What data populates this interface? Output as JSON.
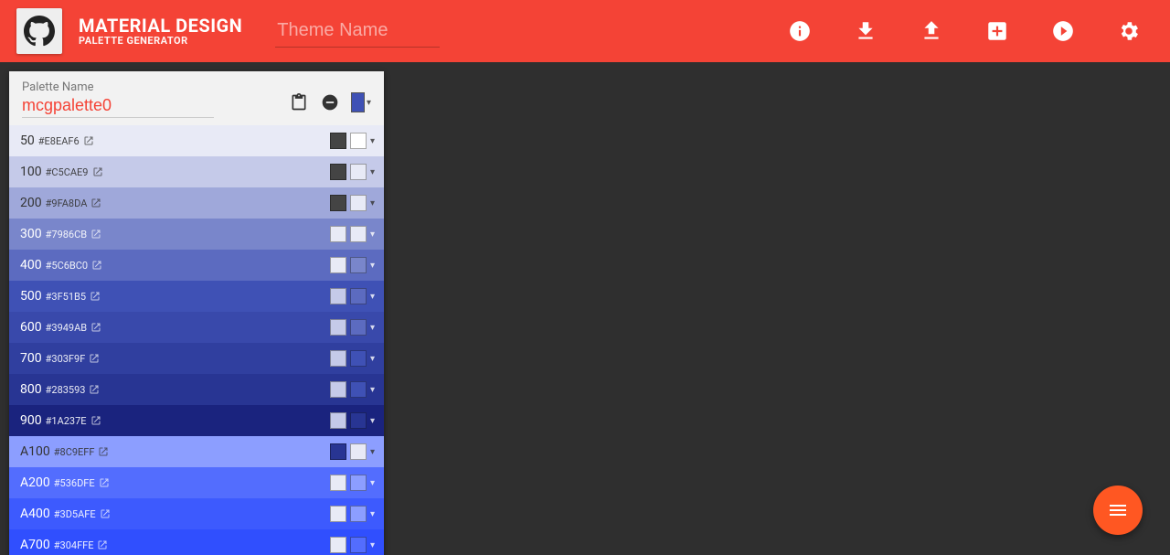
{
  "header": {
    "title": "MATERIAL DESIGN",
    "subtitle": "PALETTE GENERATOR",
    "theme_placeholder": "Theme Name",
    "theme_value": ""
  },
  "palette": {
    "name_label": "Palette Name",
    "name_value": "mcgpalette0",
    "base_color": "#3F51B5",
    "shades": [
      {
        "key": "50",
        "hex": "#E8EAF6",
        "bg": "#E8EAF6",
        "text": "dark",
        "dark_sw": "#444444",
        "light_sw": "#FFFFFF"
      },
      {
        "key": "100",
        "hex": "#C5CAE9",
        "bg": "#C5CAE9",
        "text": "dark",
        "dark_sw": "#444444",
        "light_sw": "#E8EAF6"
      },
      {
        "key": "200",
        "hex": "#9FA8DA",
        "bg": "#9FA8DA",
        "text": "dark",
        "dark_sw": "#444444",
        "light_sw": "#E8EAF6"
      },
      {
        "key": "300",
        "hex": "#7986CB",
        "bg": "#7986CB",
        "text": "light",
        "dark_sw": "#E8EAF6",
        "light_sw": "#E8EAF6"
      },
      {
        "key": "400",
        "hex": "#5C6BC0",
        "bg": "#5C6BC0",
        "text": "light",
        "dark_sw": "#E8EAF6",
        "light_sw": "#7986CB"
      },
      {
        "key": "500",
        "hex": "#3F51B5",
        "bg": "#3F51B5",
        "text": "light",
        "dark_sw": "#C5CAE9",
        "light_sw": "#5C6BC0"
      },
      {
        "key": "600",
        "hex": "#3949AB",
        "bg": "#3949AB",
        "text": "light",
        "dark_sw": "#C5CAE9",
        "light_sw": "#5C6BC0"
      },
      {
        "key": "700",
        "hex": "#303F9F",
        "bg": "#303F9F",
        "text": "light",
        "dark_sw": "#C5CAE9",
        "light_sw": "#3F51B5"
      },
      {
        "key": "800",
        "hex": "#283593",
        "bg": "#283593",
        "text": "light",
        "dark_sw": "#C5CAE9",
        "light_sw": "#3F51B5"
      },
      {
        "key": "900",
        "hex": "#1A237E",
        "bg": "#1A237E",
        "text": "light",
        "dark_sw": "#C5CAE9",
        "light_sw": "#283593"
      },
      {
        "key": "A100",
        "hex": "#8C9EFF",
        "bg": "#8C9EFF",
        "text": "dark",
        "dark_sw": "#283593",
        "light_sw": "#E8EAF6"
      },
      {
        "key": "A200",
        "hex": "#536DFE",
        "bg": "#536DFE",
        "text": "light",
        "dark_sw": "#E8EAF6",
        "light_sw": "#8C9EFF"
      },
      {
        "key": "A400",
        "hex": "#3D5AFE",
        "bg": "#3D5AFE",
        "text": "light",
        "dark_sw": "#E8EAF6",
        "light_sw": "#8C9EFF"
      },
      {
        "key": "A700",
        "hex": "#304FFE",
        "bg": "#304FFE",
        "text": "light",
        "dark_sw": "#E8EAF6",
        "light_sw": "#536DFE"
      }
    ]
  }
}
